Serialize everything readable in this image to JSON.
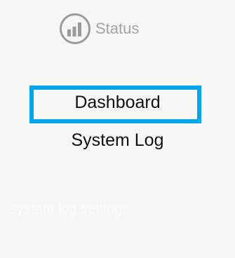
{
  "status": {
    "icon": "bar-chart-icon",
    "label": "Status"
  },
  "nav": {
    "items": [
      {
        "label": "Dashboard",
        "focused": true
      },
      {
        "label": "System Log",
        "focused": false
      }
    ]
  },
  "background_text": {
    "text": "system log settings."
  },
  "colors": {
    "background": "#f6f6f6",
    "focus": "#00a6e8",
    "status_text": "#a4a4a4",
    "status_icon": "#9b9b9b",
    "nav_text": "#111111"
  }
}
